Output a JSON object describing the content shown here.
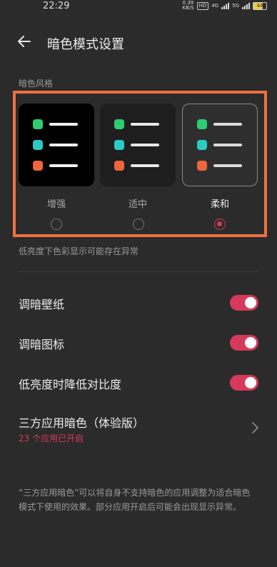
{
  "status": {
    "time": "22:29",
    "speed_value": "0.39",
    "speed_unit": "KB/S",
    "hd": "HD",
    "net1": "4G",
    "net2": "5G",
    "battery": "44"
  },
  "header": {
    "title": "暗色模式设置"
  },
  "dark_style": {
    "section_label": "暗色风格",
    "options": [
      {
        "label": "增强",
        "selected": false
      },
      {
        "label": "适中",
        "selected": false
      },
      {
        "label": "柔和",
        "selected": true
      }
    ],
    "note": "低亮度下色彩显示可能存在异常"
  },
  "settings": [
    {
      "label": "调暗壁纸",
      "enabled": true
    },
    {
      "label": "调暗图标",
      "enabled": true
    },
    {
      "label": "低亮度时降低对比度",
      "enabled": true
    }
  ],
  "third_party": {
    "label": "三方应用暗色（体验版）",
    "sub": "23 个应用已开启"
  },
  "footer_text": "“三方应用暗色”可以将自身不支持暗色的应用调整为适合暗色模式下使用的效果。部分应用开启后可能会出现显示异常。",
  "colors": {
    "accent": "#d63a5a",
    "highlight_frame": "#f0703f",
    "dot_green": "#2ecc71",
    "dot_cyan": "#2bcbc4",
    "dot_orange": "#f0643c"
  }
}
